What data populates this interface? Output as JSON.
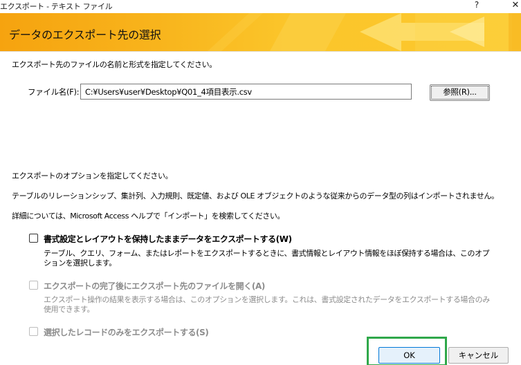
{
  "window": {
    "title": "エクスポート - テキスト ファイル",
    "help_label": "?",
    "close_label": "✕"
  },
  "banner": {
    "title": "データのエクスポート先の選択",
    "colors": {
      "start": "#f6a30f",
      "end": "#fcc92d"
    }
  },
  "instructions": {
    "specify_file": "エクスポート先のファイルの名前と形式を指定してください。",
    "specify_options": "エクスポートのオプションを指定してください。",
    "relations_note": "テーブルのリレーションシップ、集計列、入力規則、既定値、および OLE オブジェクトのような従来からのデータ型の列はインポートされません。",
    "help_note": "詳細については、Microsoft Access ヘルプで「インポート」を検索してください。"
  },
  "file": {
    "label": "ファイル名(F):",
    "value": "C:¥Users¥user¥Desktop¥Q01_4項目表示.csv",
    "browse_label": "参照(R)..."
  },
  "options": [
    {
      "label": "書式設定とレイアウトを保持したままデータをエクスポートする(W)",
      "description": "テーブル、クエリ、フォーム、またはレポートをエクスポートするときに、書式情報とレイアウト情報をほぼ保持する場合は、このオプションを選択します。",
      "checked": false,
      "enabled": true
    },
    {
      "label": "エクスポートの完了後にエクスポート先のファイルを開く(A)",
      "description": "エクスポート操作の結果を表示する場合は、このオプションを選択します。これは、書式設定されたデータをエクスポートする場合のみ使用できます。",
      "checked": false,
      "enabled": false
    },
    {
      "label": "選択したレコードのみをエクスポートする(S)",
      "checked": false,
      "enabled": false
    }
  ],
  "buttons": {
    "ok": "OK",
    "cancel": "キャンセル"
  },
  "highlight_color": "#2fa84a"
}
